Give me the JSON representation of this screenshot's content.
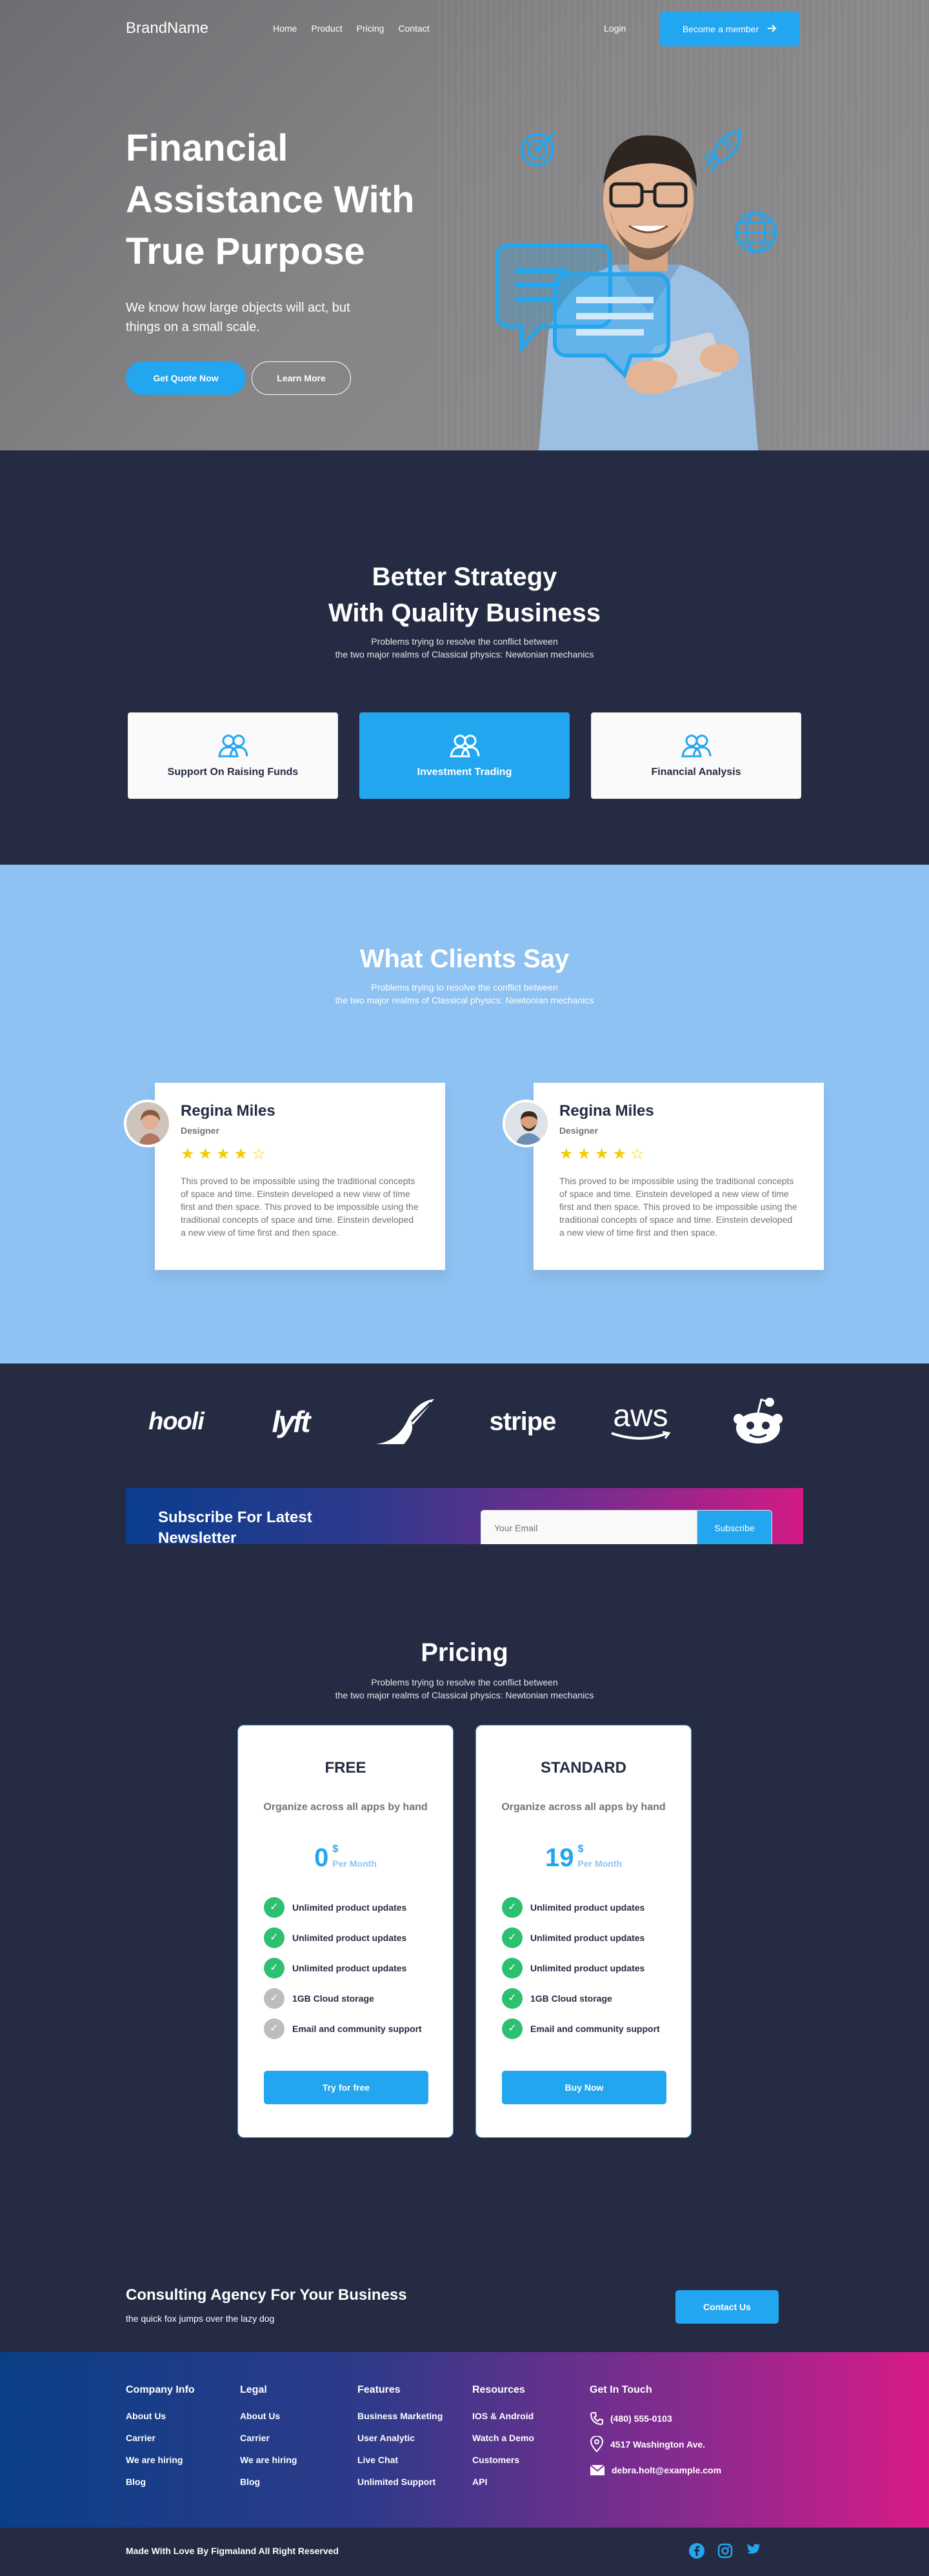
{
  "nav": {
    "brand": "BrandName",
    "links": [
      "Home",
      "Product",
      "Pricing",
      "Contact"
    ],
    "login": "Login",
    "member_button": "Become a member"
  },
  "hero": {
    "title": "Financial Assistance With True Purpose",
    "subtitle": "We know how large objects will act, but things on a small scale.",
    "quote_button": "Get Quote Now",
    "learn_button": "Learn More"
  },
  "strategy": {
    "title_line1": "Better Strategy",
    "title_line2": "With Quality Business",
    "desc_line1": "Problems trying to resolve the conflict between",
    "desc_line2": "the two major realms of Classical physics: Newtonian mechanics",
    "cards": [
      {
        "label": "Support On Raising Funds",
        "active": false
      },
      {
        "label": "Investment Trading",
        "active": true
      },
      {
        "label": "Financial Analysis",
        "active": false
      }
    ]
  },
  "testimonials": {
    "title": "What Clients Say",
    "desc_line1": "Problems trying to resolve the conflict between",
    "desc_line2": "the two major realms of Classical physics: Newtonian mechanics",
    "items": [
      {
        "name": "Regina Miles",
        "role": "Designer",
        "rating": 4,
        "text": "This proved to be impossible using the traditional concepts of space and time. Einstein developed a new view of time first and then space. This proved to be impossible using the traditional concepts of space and time. Einstein developed a new view of time first and then space."
      },
      {
        "name": "Regina Miles",
        "role": "Designer",
        "rating": 4,
        "text": "This proved to be impossible using the traditional concepts of space and time. Einstein developed a new view of time first and then space. This proved to be impossible using the traditional concepts of space and time. Einstein developed a new view of time first and then space."
      }
    ]
  },
  "logos": [
    "hooli-logo",
    "lyft-logo",
    "leaf-logo",
    "stripe-logo",
    "aws-logo",
    "reddit-logo"
  ],
  "logo_text": {
    "hooli": "hooli",
    "lyft": "lyft",
    "stripe": "stripe",
    "aws": "aws"
  },
  "newsletter": {
    "title": "Subscribe For Latest Newsletter",
    "placeholder": "Your Email",
    "button": "Subscribe"
  },
  "pricing": {
    "title": "Pricing",
    "desc_line1": "Problems trying to resolve the conflict between",
    "desc_line2": "the two major realms of Classical physics: Newtonian mechanics",
    "plans": [
      {
        "name": "FREE",
        "desc": "Organize across all apps by hand",
        "amount": "0",
        "currency": "$",
        "period": "Per Month",
        "features": [
          {
            "text": "Unlimited product updates",
            "included": true
          },
          {
            "text": "Unlimited product updates",
            "included": true
          },
          {
            "text": "Unlimited product updates",
            "included": true
          },
          {
            "text": "1GB  Cloud storage",
            "included": false
          },
          {
            "text": "Email and community support",
            "included": false
          }
        ],
        "button": "Try for free"
      },
      {
        "name": "STANDARD",
        "desc": "Organize across all apps by hand",
        "amount": "19",
        "currency": "$",
        "period": "Per Month",
        "features": [
          {
            "text": "Unlimited product updates",
            "included": true
          },
          {
            "text": "Unlimited product updates",
            "included": true
          },
          {
            "text": "Unlimited product updates",
            "included": true
          },
          {
            "text": "1GB  Cloud storage",
            "included": true
          },
          {
            "text": "Email and community support",
            "included": true
          }
        ],
        "button": "Buy Now"
      }
    ]
  },
  "cta": {
    "title": "Consulting Agency For Your Business",
    "subtitle": "the quick fox jumps over the lazy dog",
    "button": "Contact Us"
  },
  "footer": {
    "columns": [
      {
        "title": "Company Info",
        "links": [
          "About Us",
          "Carrier",
          "We are hiring",
          "Blog"
        ]
      },
      {
        "title": "Legal",
        "links": [
          "About Us",
          "Carrier",
          "We are hiring",
          "Blog"
        ]
      },
      {
        "title": "Features",
        "links": [
          "Business Marketing",
          "User Analytic",
          "Live Chat",
          "Unlimited Support"
        ]
      },
      {
        "title": "Resources",
        "links": [
          "IOS & Android",
          "Watch a Demo",
          "Customers",
          "API"
        ]
      }
    ],
    "contact": {
      "title": "Get In Touch",
      "phone": "(480) 555-0103",
      "address": "4517 Washington Ave.",
      "email": "debra.holt@example.com"
    },
    "copyright": "Made With Love By Figmaland All Right Reserved"
  },
  "colors": {
    "primary": "#23a6f0",
    "dark": "#252b42",
    "light_blue": "#8ec2f2",
    "success": "#2dc071",
    "star": "#f3cd03"
  }
}
